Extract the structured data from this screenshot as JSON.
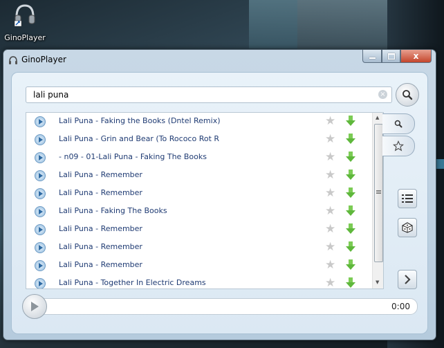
{
  "desktop": {
    "shortcut_label": "GinoPlayer",
    "shortcut_icon": "headphones-icon"
  },
  "window": {
    "title": "GinoPlayer",
    "app_icon": "headphones-icon",
    "caption_buttons": {
      "minimize": "minimize-icon",
      "maximize": "maximize-icon",
      "close": "close-icon"
    },
    "close_glyph": "x"
  },
  "search": {
    "value": "lali puna",
    "clear_glyph": "×",
    "search_icon": "search-icon"
  },
  "results": [
    {
      "title": "Lali Puna - Faking the Books (Dntel Remix)"
    },
    {
      "title": "Lali Puna - Grin and Bear (To Rococo Rot R"
    },
    {
      "title": " - n09 - 01-Lali Puna - Faking The Books"
    },
    {
      "title": "Lali Puna - Remember"
    },
    {
      "title": "Lali Puna - Remember"
    },
    {
      "title": "Lali Puna - Faking The Books"
    },
    {
      "title": "Lali Puna - Remember"
    },
    {
      "title": "Lali Puna - Remember"
    },
    {
      "title": "Lali Puna - Remember"
    },
    {
      "title": "Lali Puna - Together In Electric Dreams"
    }
  ],
  "row_icons": {
    "play": "play-icon",
    "favorite": "star-icon",
    "download": "download-arrow-icon"
  },
  "side_tabs": [
    {
      "name": "search-tab",
      "icon": "search-icon"
    },
    {
      "name": "favorites-tab",
      "icon": "star-icon"
    }
  ],
  "side_buttons": [
    {
      "name": "playlist-button",
      "icon": "list-icon"
    },
    {
      "name": "random-button",
      "icon": "dice-icon"
    },
    {
      "name": "next-button",
      "icon": "chevron-right-icon"
    }
  ],
  "player": {
    "time": "0:00",
    "play_icon": "play-icon"
  },
  "colors": {
    "accent": "#2e6aa3",
    "track_text": "#1f3b73",
    "download_green": "#6cc24a",
    "close_red": "#c4452c"
  }
}
